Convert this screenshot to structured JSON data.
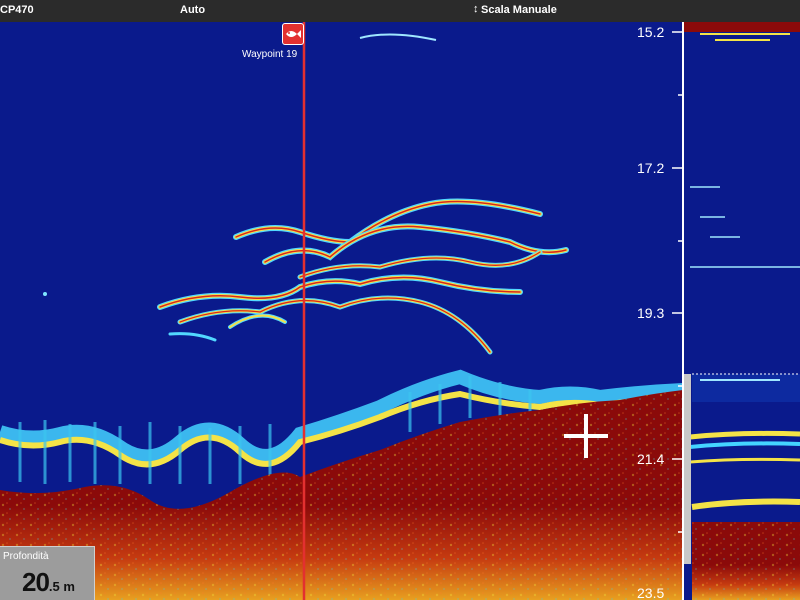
{
  "topbar": {
    "source": "CP470",
    "mode": "Auto",
    "range_mode": "Scala Manuale",
    "range_icon": "up-down-arrows-icon"
  },
  "depth_scale": {
    "labels": [
      "15.2",
      "17.2",
      "19.3",
      "21.4",
      "23.5"
    ]
  },
  "waypoint": {
    "label": "Waypoint 19",
    "icon": "fish-waypoint-icon",
    "color": "#e33030"
  },
  "depth_readout": {
    "title": "Profondità",
    "integer": "20",
    "decimal": ".5",
    "unit": "m"
  },
  "colors": {
    "water": "#0a1a8c",
    "bottom": "#8b0a0a",
    "marker_line": "#e33030",
    "bar": "#2b2b2b"
  }
}
